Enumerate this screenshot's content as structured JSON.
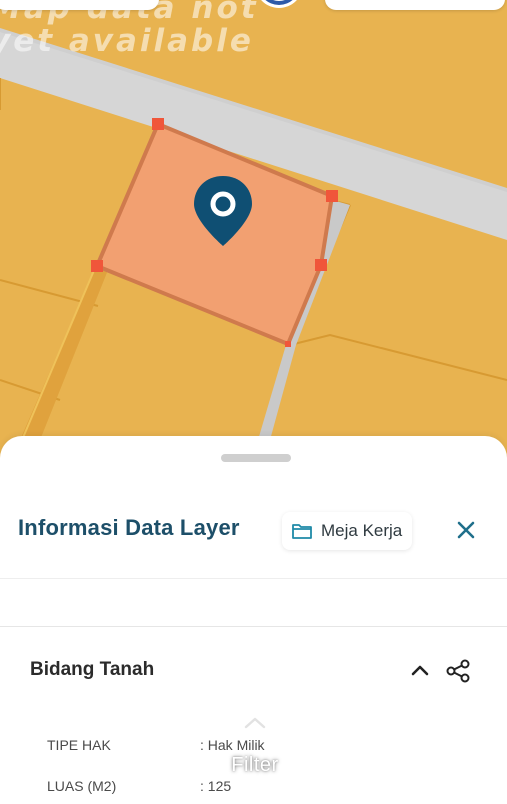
{
  "map": {
    "watermark_line1": "Map data not",
    "watermark_line2": "yet available",
    "colors": {
      "land": "#e8b350",
      "road": "#d6d6d6",
      "parcel_border": "#d79a32",
      "selected_fill": "#f2a071",
      "selected_border": "#cf7a4d",
      "vertex": "#f0563a",
      "marker": "#0f4f73"
    },
    "icons": {
      "marker": "map-pin-icon",
      "compass": "compass-icon"
    }
  },
  "sheet": {
    "title": "Informasi Data Layer",
    "workspace_label": "Meja Kerja",
    "icons": {
      "workspace": "folder-icon",
      "close": "close-icon",
      "collapse": "chevron-up-icon",
      "share": "share-icon",
      "filter": "chevron-up-icon"
    },
    "section": {
      "title": "Bidang Tanah",
      "attributes": [
        {
          "key": "TIPE HAK",
          "value": ": Hak Milik"
        },
        {
          "key": "LUAS (M2)",
          "value": ": 125"
        }
      ]
    },
    "filter_label": "Filter",
    "colors": {
      "title": "#1d4f69",
      "accent": "#1f6f8b"
    }
  }
}
